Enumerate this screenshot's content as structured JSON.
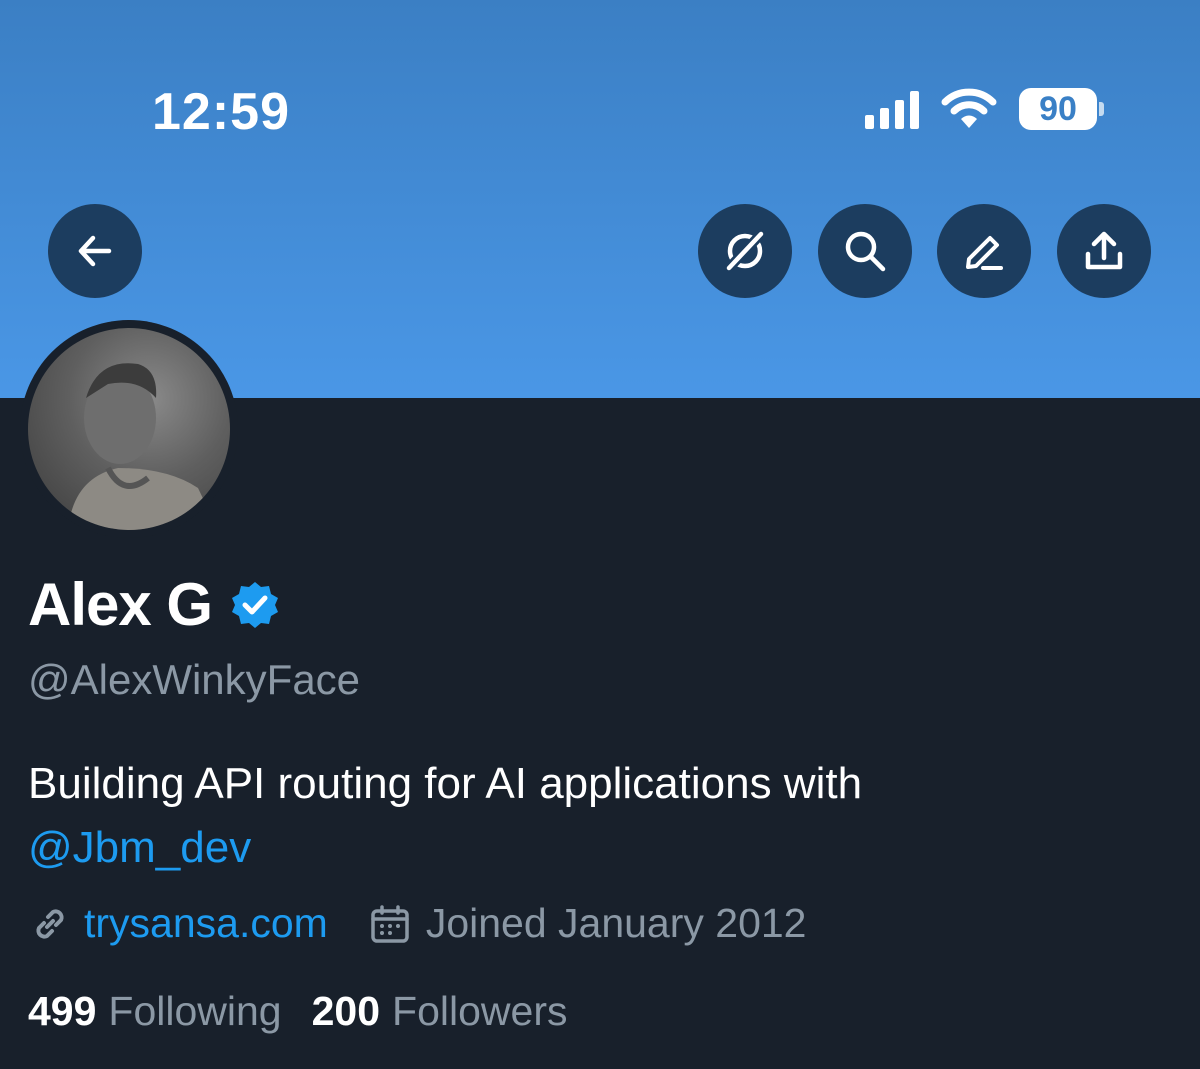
{
  "status_bar": {
    "time": "12:59",
    "battery": "90",
    "icons": [
      "cellular-signal-icon",
      "wifi-icon",
      "battery-icon"
    ]
  },
  "nav": {
    "icons": [
      "back-arrow-icon",
      "grok-icon",
      "search-icon",
      "edit-icon",
      "share-icon"
    ]
  },
  "colors": {
    "banner_top": "#3b7fc4",
    "banner_bottom": "#4a97e6",
    "background": "#18202b",
    "accent": "#1d9bf0",
    "muted": "#8b98a5",
    "button_bg": "#1c3d5f"
  },
  "profile": {
    "name": "Alex G",
    "verified": true,
    "handle": "@AlexWinkyFace",
    "bio_text": "Building API routing for AI applications with",
    "bio_mention": "@Jbm_dev",
    "website": "trysansa.com",
    "joined": "Joined January 2012",
    "following_count": "499",
    "following_label": "Following",
    "followers_count": "200",
    "followers_label": "Followers"
  }
}
